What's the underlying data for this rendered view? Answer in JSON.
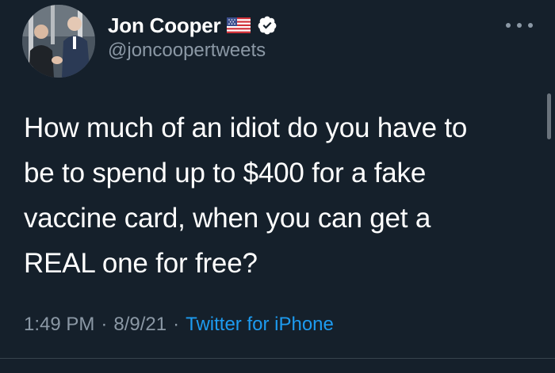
{
  "tweet": {
    "author": {
      "display_name": "Jon Cooper",
      "handle": "@joncoopertweets",
      "flag_icon": "us-flag-icon",
      "verified_icon": "verified-badge-icon",
      "verified_color": "#ffffff"
    },
    "more_icon": "more-dots-icon",
    "text_lines": [
      "How much of an idiot do you have to",
      "be to spend up to $400 for a fake",
      "vaccine card, when you can get a",
      "REAL one for free?"
    ],
    "time": "1:49 PM",
    "separator": "·",
    "date": "8/9/21",
    "source": "Twitter for iPhone"
  },
  "colors": {
    "background": "#15202b",
    "text": "#ffffff",
    "secondary_text": "#8b98a5",
    "link": "#1d9bf0",
    "divider": "#38444d"
  }
}
